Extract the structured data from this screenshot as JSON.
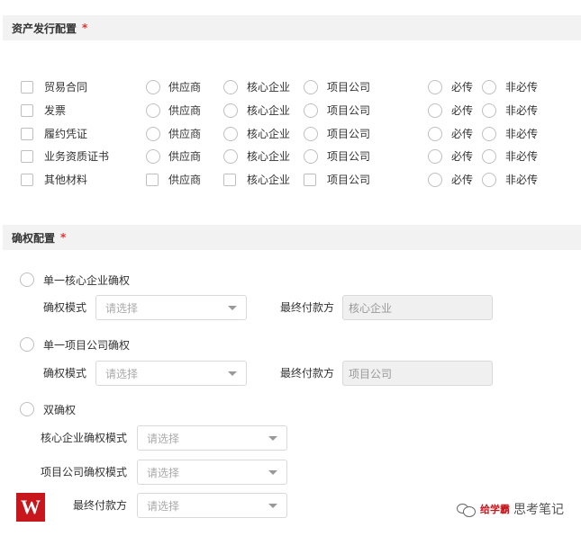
{
  "asset_section": {
    "title": "资产发行配置",
    "required_mark": "*",
    "rows": [
      {
        "name": "贸易合同",
        "party_a": "供应商",
        "party_b": "核心企业",
        "party_c": "项目公司",
        "req": "必传",
        "opt": "非必传"
      },
      {
        "name": "发票",
        "party_a": "供应商",
        "party_b": "核心企业",
        "party_c": "项目公司",
        "req": "必传",
        "opt": "非必传"
      },
      {
        "name": "履约凭证",
        "party_a": "供应商",
        "party_b": "核心企业",
        "party_c": "项目公司",
        "req": "必传",
        "opt": "非必传"
      },
      {
        "name": "业务资质证书",
        "party_a": "供应商",
        "party_b": "核心企业",
        "party_c": "项目公司",
        "req": "必传",
        "opt": "非必传"
      },
      {
        "name": "其他材料",
        "party_a": "供应商",
        "party_b": "核心企业",
        "party_c": "项目公司",
        "req": "必传",
        "opt": "非必传"
      }
    ]
  },
  "confirm_section": {
    "title": "确权配置",
    "required_mark": "*",
    "option1": {
      "label": "单一核心企业确权",
      "mode_label": "确权模式",
      "mode_placeholder": "请选择",
      "payer_label": "最终付款方",
      "payer_value": "核心企业"
    },
    "option2": {
      "label": "单一项目公司确权",
      "mode_label": "确权模式",
      "mode_placeholder": "请选择",
      "payer_label": "最终付款方",
      "payer_value": "项目公司"
    },
    "option3": {
      "label": "双确权",
      "core_mode_label": "核心企业确权模式",
      "core_mode_placeholder": "请选择",
      "project_mode_label": "项目公司确权模式",
      "project_mode_placeholder": "请选择",
      "payer_label": "最终付款方",
      "payer_placeholder": "请选择"
    }
  },
  "watermark": {
    "logo_letter": "W",
    "text_red": "给学霸",
    "text": "思考笔记"
  },
  "colors": {
    "required": "#e0312f",
    "header_bg": "#f2f2f2",
    "brand_red": "#c8161d"
  }
}
